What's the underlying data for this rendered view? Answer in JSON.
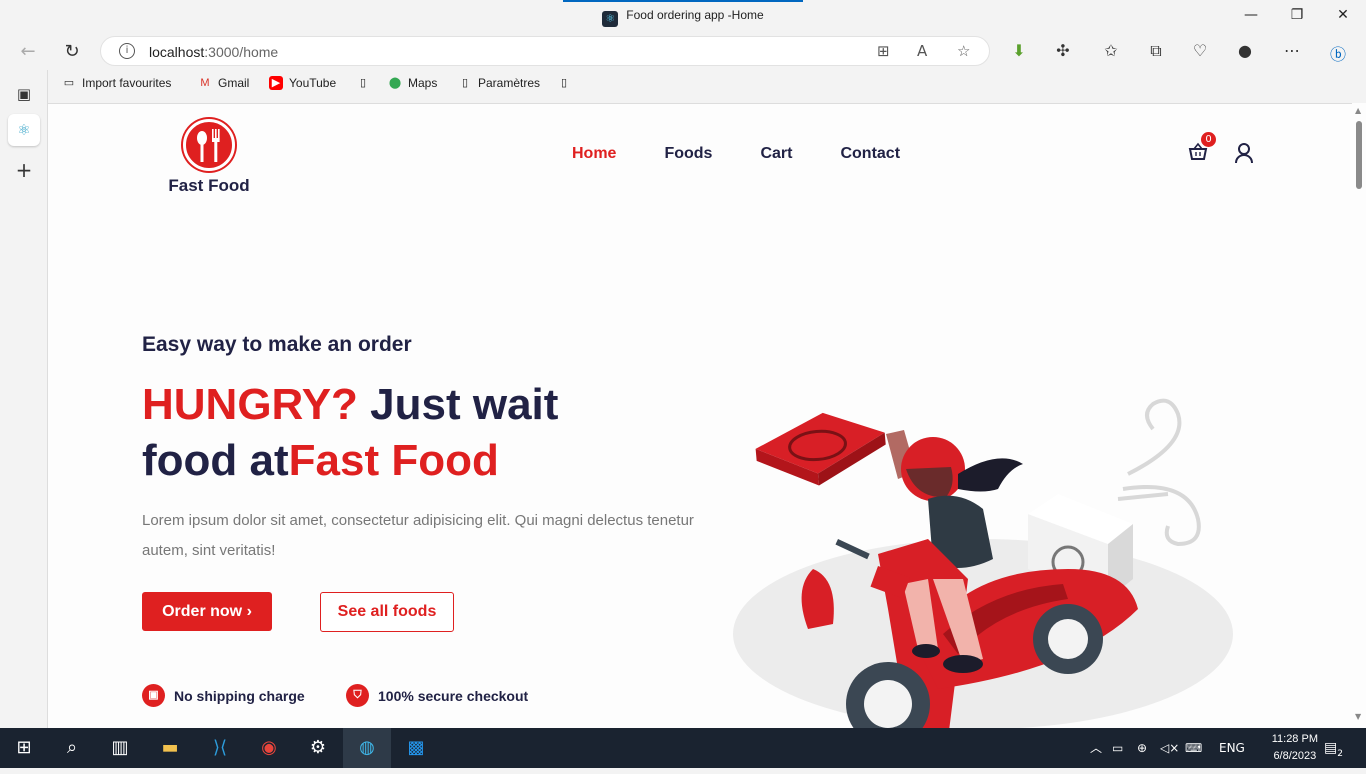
{
  "window": {
    "tab_title": "Food ordering app -Home",
    "favicon": "react-icon",
    "controls": {
      "minimize": "—",
      "restore": "❐",
      "close": "✕"
    }
  },
  "browser": {
    "url_host": "localhost",
    "url_path": ":3000/home",
    "bookmarks": [
      {
        "label": "Import favourites",
        "icon": "import-icon"
      },
      {
        "label": "Gmail",
        "icon": "gmail-icon"
      },
      {
        "label": "YouTube",
        "icon": "youtube-icon"
      },
      {
        "label": "",
        "icon": "page-icon"
      },
      {
        "label": "Maps",
        "icon": "maps-icon"
      },
      {
        "label": "Paramètres",
        "icon": "page-icon"
      },
      {
        "label": "",
        "icon": "page-icon"
      }
    ]
  },
  "site": {
    "logo_name": "Fast Food",
    "menu": [
      "Home",
      "Foods",
      "Cart",
      "Contact"
    ],
    "active_menu": "Home",
    "cart_count": "0"
  },
  "hero": {
    "subtitle": "Easy way to make an order",
    "title_red_1": "HUNGRY?",
    "title_dark_1": " Just wait",
    "title_dark_2": "food at",
    "title_red_2": "Fast Food",
    "description": "Lorem ipsum dolor sit amet, consectetur adipisicing elit. Qui magni delectus tenetur autem, sint veritatis!",
    "order_button": "Order now ›",
    "all_foods_button": "See all foods",
    "features": [
      "No shipping charge",
      "100% secure checkout"
    ]
  },
  "taskbar": {
    "lang": "ENG",
    "time": "11:28 PM",
    "date": "6/8/2023",
    "notifications": "2"
  },
  "colors": {
    "brand_red": "#df2020",
    "dark_text": "#212245",
    "taskbar": "#1a2330"
  }
}
